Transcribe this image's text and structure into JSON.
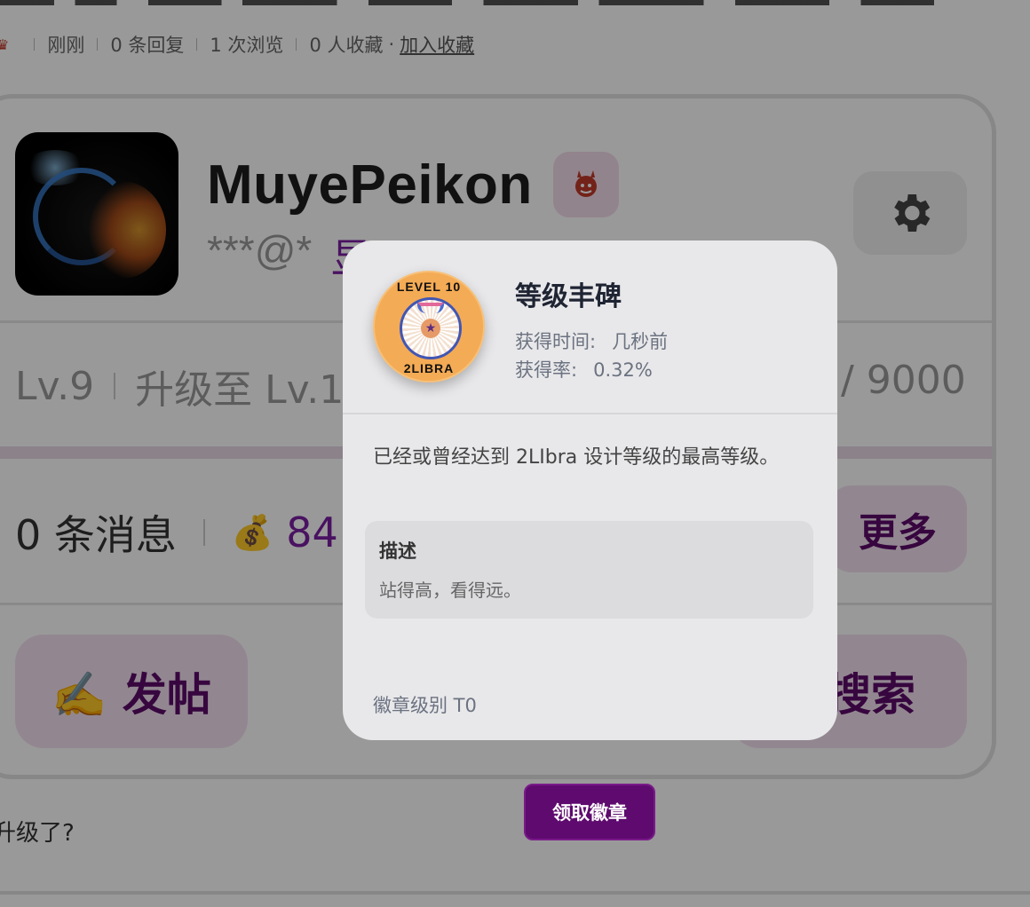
{
  "meta": {
    "crown_icon": "crown-icon",
    "posted": "刚刚",
    "replies": "0 条回复",
    "views": "1 次浏览",
    "favorites": "0 人收藏",
    "dot": "·",
    "add_favorite": "加入收藏"
  },
  "profile": {
    "username": "MuyePeikon",
    "email_masked": "***@*",
    "show_label": "显示",
    "badge_icon": "devil-icon",
    "settings_icon": "gear-icon"
  },
  "level": {
    "current": "Lv.9",
    "next_label": "升级至 Lv.10",
    "total": "/ 9000",
    "progress_fraction": 0.99
  },
  "stats": {
    "messages": "0 条消息",
    "coin_icon": "money-bag-icon",
    "coins": "84",
    "more_label": "更多"
  },
  "actions": {
    "post_label": "✍️ 发帖",
    "search_label": "搜索"
  },
  "question": "升级了?",
  "modal": {
    "title": "等级丰碑",
    "obtained_label": "获得时间:",
    "obtained_value": "几秒前",
    "rate_label": "获得率:",
    "rate_value": "0.32%",
    "description": "已经或曾经达到 2LIbra 设计等级的最高等级。",
    "desc_heading": "描述",
    "desc_text": "站得高，看得远。",
    "tier": "徽章级别 T0",
    "medal_top": "LEVEL 10",
    "medal_bottom": "2LIBRA"
  },
  "claim_button": "领取徽章",
  "colors": {
    "accent": "#5e0a6e",
    "accent_soft": "#f4e2f0",
    "link_purple": "#7b1fa2"
  }
}
